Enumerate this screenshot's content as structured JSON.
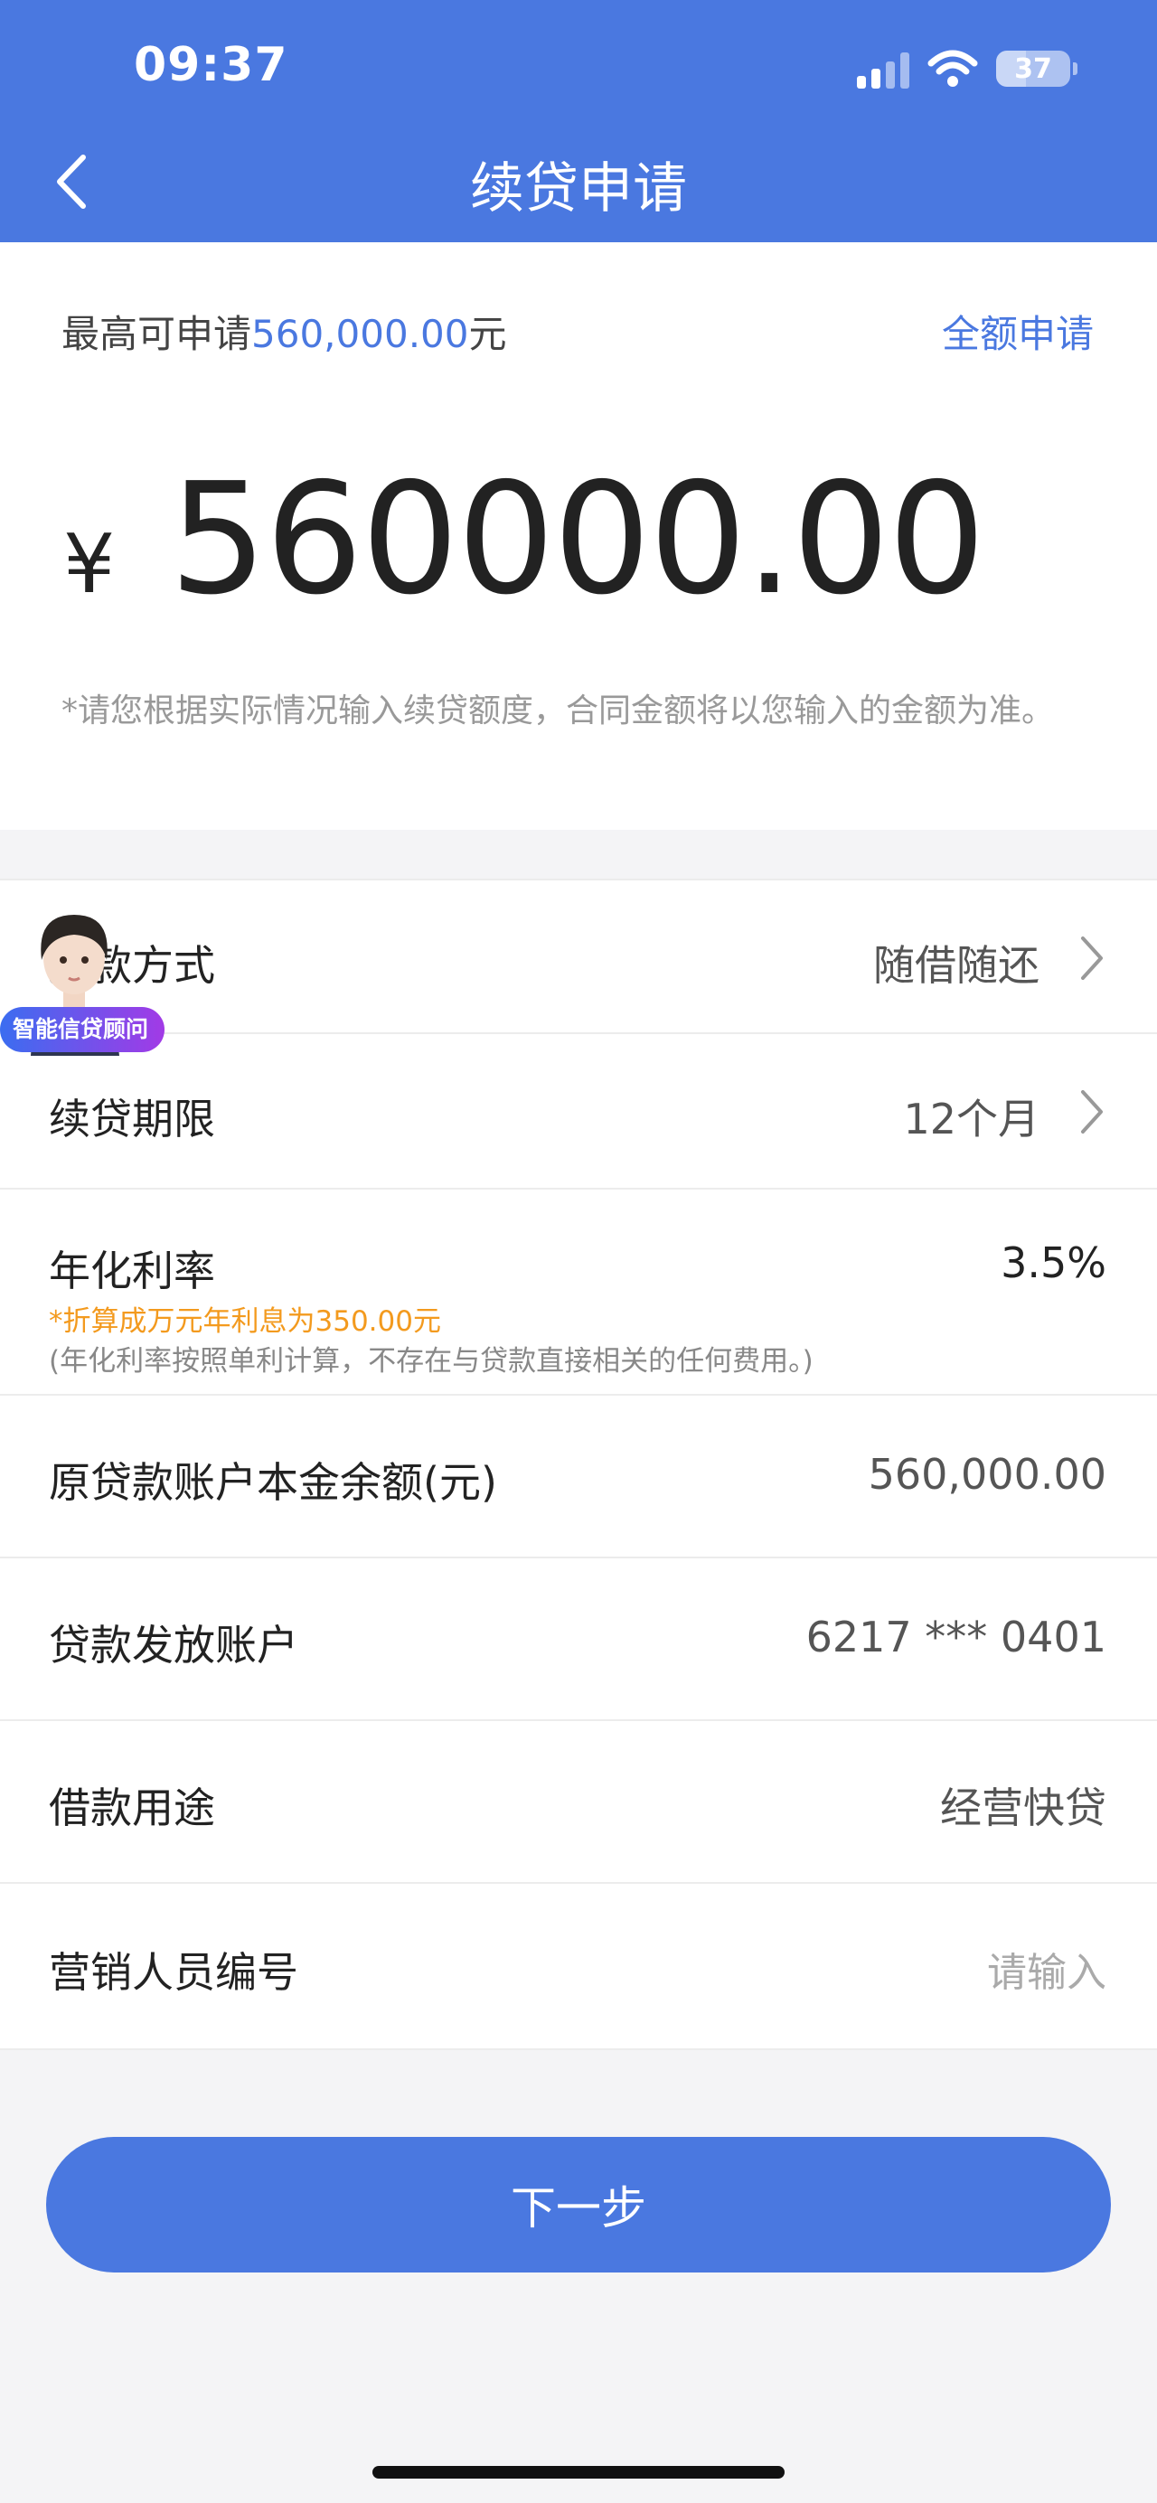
{
  "status_bar": {
    "time": "09:37",
    "battery": "37"
  },
  "header": {
    "title": "续贷申请"
  },
  "amount_card": {
    "max_prefix": "最高可申请",
    "max_amount": "560,000.00",
    "max_suffix": "元",
    "full_apply": "全额申请",
    "currency": "¥",
    "amount": "560000.00",
    "hint": "*请您根据实际情况输入续贷额度，合同金额将以您输入的金额为准。"
  },
  "advisor": {
    "badge": "智能信贷顾问"
  },
  "rows": {
    "repayment": {
      "label": "还款方式",
      "value": "随借随还"
    },
    "term": {
      "label": "续贷期限",
      "value": "12个月"
    },
    "rate": {
      "label": "年化利率",
      "value": "3.5%",
      "note1": "*折算成万元年利息为350.00元",
      "note2": "(年化利率按照单利计算，不存在与贷款直接相关的任何费用。)"
    },
    "principal": {
      "label": "原贷款账户本金余额(元)",
      "value": "560,000.00"
    },
    "account": {
      "label": "贷款发放账户",
      "value": "6217 *** 0401"
    },
    "purpose": {
      "label": "借款用途",
      "value": "经营快贷"
    },
    "marketer": {
      "label": "营销人员编号",
      "placeholder": "请输入"
    }
  },
  "actions": {
    "next": "下一步"
  },
  "colors": {
    "primary": "#4a78e0",
    "accent_orange": "#f39a1e"
  }
}
